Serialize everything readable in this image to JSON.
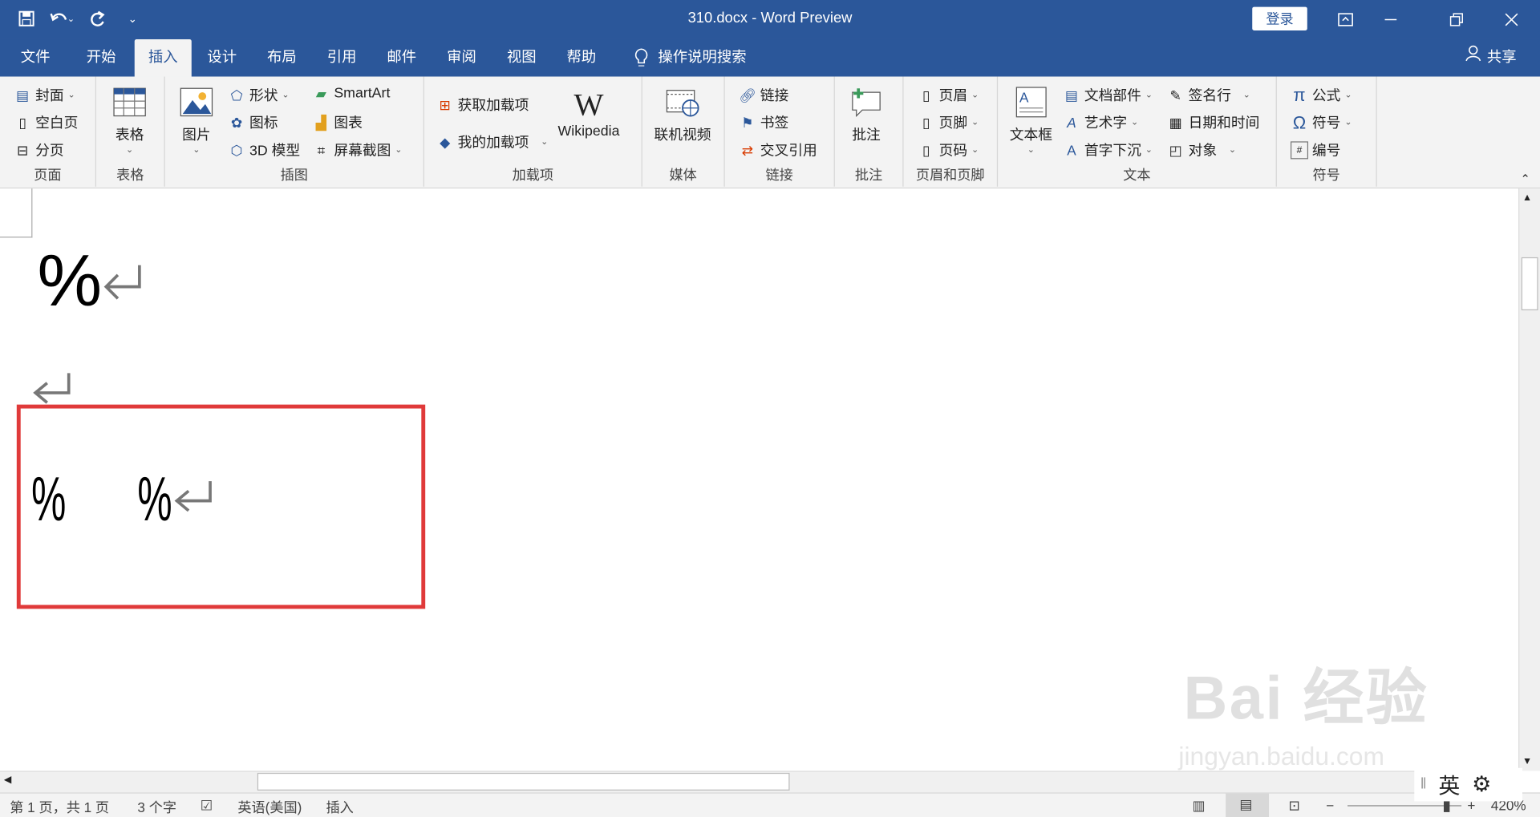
{
  "titlebar": {
    "title": "310.docx  -  Word Preview",
    "login": "登录"
  },
  "tabs": [
    "文件",
    "开始",
    "插入",
    "设计",
    "布局",
    "引用",
    "邮件",
    "审阅",
    "视图",
    "帮助",
    "操作说明搜索"
  ],
  "share": "共享",
  "ribbon": {
    "page": {
      "label": "页面",
      "items": [
        "封面",
        "空白页",
        "分页"
      ]
    },
    "table": {
      "label": "表格",
      "btn": "表格"
    },
    "illus": {
      "label": "插图",
      "pic": "图片",
      "items": [
        "形状",
        "图标",
        "3D 模型",
        "SmartArt",
        "图表",
        "屏幕截图"
      ]
    },
    "addins": {
      "label": "加载项",
      "items": [
        "获取加载项",
        "我的加载项"
      ],
      "wiki": "Wikipedia"
    },
    "media": {
      "label": "媒体",
      "btn": "联机视频"
    },
    "links": {
      "label": "链接",
      "items": [
        "链接",
        "书签",
        "交叉引用"
      ]
    },
    "comment": {
      "label": "批注",
      "btn": "批注"
    },
    "hf": {
      "label": "页眉和页脚",
      "items": [
        "页眉",
        "页脚",
        "页码"
      ]
    },
    "text": {
      "label": "文本",
      "tb": "文本框",
      "items": [
        "文档部件",
        "艺术字",
        "首字下沉",
        "签名行",
        "日期和时间",
        "对象"
      ]
    },
    "symbols": {
      "label": "符号",
      "items": [
        "公式",
        "符号",
        "编号"
      ]
    }
  },
  "doc": {
    "p1": "%",
    "p3a": "%",
    "p3b": "%"
  },
  "status": {
    "page": "第 1 页，共 1 页",
    "words": "3 个字",
    "lang": "英语(美国)",
    "mode": "插入",
    "zoom": "420%",
    "ime": "英"
  },
  "watermark": {
    "logo": "Bai 经验",
    "url": "jingyan.baidu.com"
  }
}
